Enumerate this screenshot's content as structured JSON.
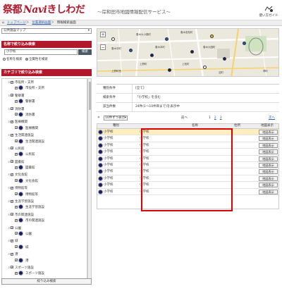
{
  "header": {
    "logo_main": "祭都",
    "logo_navi": "Navi",
    "logo_kishiwada": "きしわだ",
    "subtitle": "〜岸和田市地図情報配信サービス〜",
    "guide_label": "使い方ガイド",
    "accent_color": "#b0182c"
  },
  "breadcrumb": {
    "home_icon": "home-icon",
    "items": [
      "トップページ",
      "位置選択画面"
    ],
    "current": "情報検索画面"
  },
  "sidebar": {
    "map_select": "公共施設マップ",
    "name_search_title": "名称で絞り込み検索",
    "search_value": "小学校",
    "search_button": "検索",
    "radio_name": "名称を検索",
    "radio_all": "全属性を検索",
    "category_title": "カテゴリで絞り込み検索",
    "filter_button": "絞り込み検索",
    "tree": [
      {
        "level": 0,
        "label": "市役所・支所"
      },
      {
        "level": 1,
        "label": "市役所・支所"
      },
      {
        "level": 0,
        "label": "警察署"
      },
      {
        "level": 1,
        "label": "警察署"
      },
      {
        "level": 0,
        "label": "消防署"
      },
      {
        "level": 1,
        "label": "消防署"
      },
      {
        "level": 0,
        "label": "医療機関"
      },
      {
        "level": 1,
        "label": "医療機関"
      },
      {
        "level": 0,
        "label": "生活関連施設"
      },
      {
        "level": 1,
        "label": "生活関連施設"
      },
      {
        "level": 0,
        "label": "公民館"
      },
      {
        "level": 1,
        "label": "公民館"
      },
      {
        "level": 0,
        "label": "図書館"
      },
      {
        "level": 1,
        "label": "図書館"
      },
      {
        "level": 0,
        "label": "文化会館"
      },
      {
        "level": 1,
        "label": "文化会館"
      },
      {
        "level": 0,
        "label": "博物館等"
      },
      {
        "level": 1,
        "label": "博物館等"
      },
      {
        "level": 0,
        "label": "生涯学習施設"
      },
      {
        "level": 1,
        "label": "生涯学習施設"
      },
      {
        "level": 0,
        "label": "市の関連施設"
      },
      {
        "level": 1,
        "label": "市の関連施設"
      },
      {
        "level": 0,
        "label": "公園"
      },
      {
        "level": 1,
        "label": "公園"
      },
      {
        "level": 0,
        "label": "城"
      },
      {
        "level": 1,
        "label": "城"
      },
      {
        "level": 0,
        "label": "港"
      },
      {
        "level": 1,
        "label": "港"
      },
      {
        "level": 0,
        "label": "スポーツ施設"
      },
      {
        "level": 1,
        "label": "スポーツ施設"
      }
    ]
  },
  "map": {
    "labels": [
      "春木大小路町",
      "春木若松町",
      "春木中町",
      "春木本町",
      "春木大国町",
      "上野町",
      "上松町",
      "沼町",
      "上野町西",
      "堺町"
    ],
    "zoom_plus": "+",
    "zoom_minus": "−"
  },
  "conditions": {
    "rows": [
      {
        "key": "種別条件",
        "value": "[全て]"
      },
      {
        "key": "検索条件",
        "value": "「小学校」を含む"
      },
      {
        "key": "該当件数",
        "value": "24件(1〜10件目まで)を表示中"
      }
    ]
  },
  "paging": {
    "first_symbol": "«",
    "per_page": "10件ずつ表示",
    "prev": "前へ",
    "pages": [
      "1",
      "2",
      "3"
    ],
    "next": "次へ"
  },
  "table": {
    "headers": {
      "kind": "種別",
      "name": "名称",
      "address": "住所",
      "map": "地図表示"
    },
    "rows": [
      {
        "kind": "小学校",
        "name": "小学校",
        "button": "地図表示",
        "highlight": true
      },
      {
        "kind": "小学校",
        "name": "小学校",
        "button": "地図表示",
        "highlight": false
      },
      {
        "kind": "小学校",
        "name": "小学校",
        "button": "地図表示",
        "highlight": false
      },
      {
        "kind": "小学校",
        "name": "小学校",
        "button": "地図表示",
        "highlight": false
      },
      {
        "kind": "小学校",
        "name": "小学校",
        "button": "地図表示",
        "highlight": false
      },
      {
        "kind": "小学校",
        "name": "小学校",
        "button": "地図表示",
        "highlight": false
      },
      {
        "kind": "小学校",
        "name": "小学校",
        "button": "地図表示",
        "highlight": false
      },
      {
        "kind": "小学校",
        "name": "小学校",
        "button": "地図表示",
        "highlight": false
      },
      {
        "kind": "小学校",
        "name": "小学校",
        "button": "地図表示",
        "highlight": false
      },
      {
        "kind": "小学校",
        "name": "小学校",
        "button": "地図表示",
        "highlight": false
      }
    ]
  }
}
